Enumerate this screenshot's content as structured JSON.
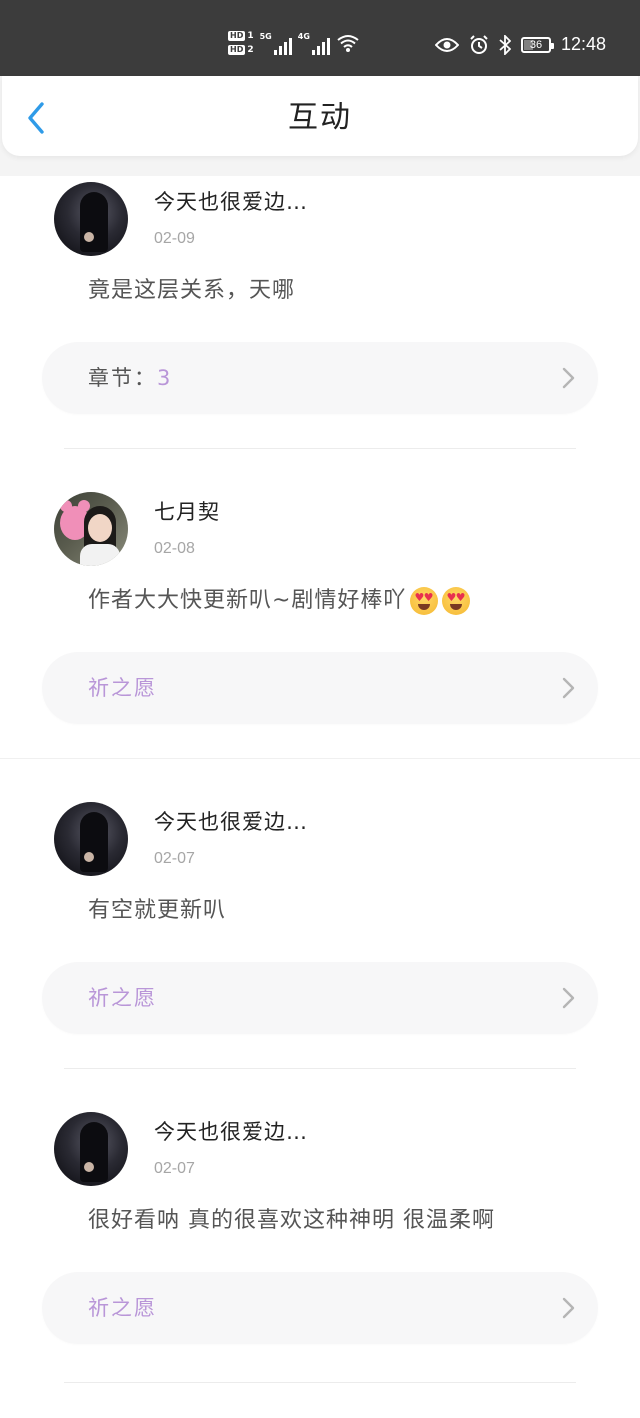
{
  "status_bar": {
    "hd1": "HD",
    "hd1_sub": "1",
    "hd2": "HD",
    "hd2_sub": "2",
    "net1": "5G",
    "net2": "4G",
    "battery": "36",
    "time": "12:48",
    "icons": [
      "signal-icon",
      "wifi-icon",
      "eye-icon",
      "alarm-icon",
      "bluetooth-icon",
      "battery-icon"
    ]
  },
  "header": {
    "title": "互动",
    "back_icon": "chevron-left-icon",
    "accent_color": "#2f9be8"
  },
  "comments": [
    {
      "username": "今天也很爱边…",
      "date": "02-09",
      "text": "竟是这层关系，天哪",
      "ref_label": "章节：",
      "ref_value": "3"
    },
    {
      "username": "七月契",
      "date": "02-08",
      "text": "作者大大快更新叭~剧情好棒吖",
      "emojis": [
        "heart-eyes-emoji",
        "heart-eyes-emoji"
      ],
      "ref_label": "祈之愿"
    },
    {
      "username": "今天也很爱边…",
      "date": "02-07",
      "text": "有空就更新叭",
      "ref_label": "祈之愿"
    },
    {
      "username": "今天也很爱边…",
      "date": "02-07",
      "text": "很好看呐 真的很喜欢这种神明 很温柔啊",
      "ref_label": "祈之愿"
    }
  ],
  "colors": {
    "ref_purple": "#b996d8",
    "ref_bg": "#f7f7f8"
  }
}
